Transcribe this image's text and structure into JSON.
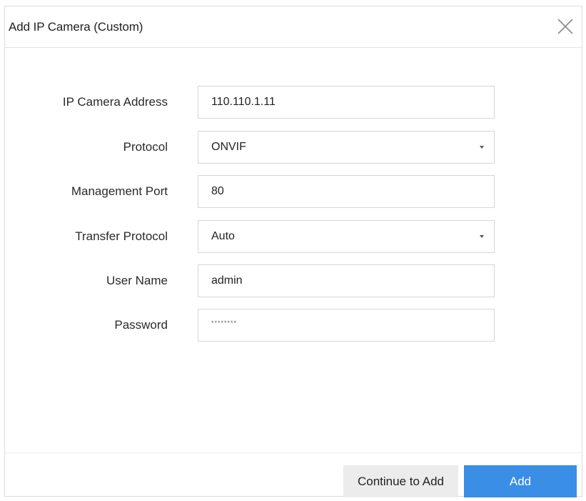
{
  "dialog": {
    "title": "Add IP Camera (Custom)"
  },
  "form": {
    "ip_address": {
      "label": "IP Camera Address",
      "value": "110.110.1.11"
    },
    "protocol": {
      "label": "Protocol",
      "value": "ONVIF"
    },
    "management_port": {
      "label": "Management Port",
      "value": "80"
    },
    "transfer_protocol": {
      "label": "Transfer Protocol",
      "value": "Auto"
    },
    "user_name": {
      "label": "User Name",
      "value": "admin"
    },
    "password": {
      "label": "Password",
      "value": "********"
    }
  },
  "footer": {
    "continue_label": "Continue to Add",
    "add_label": "Add"
  },
  "colors": {
    "primary": "#3a8ee6",
    "secondary_button": "#ececec",
    "border": "#d6d6d6"
  },
  "icons": {
    "close": "close-icon",
    "dropdown": "chevron-down-icon"
  }
}
